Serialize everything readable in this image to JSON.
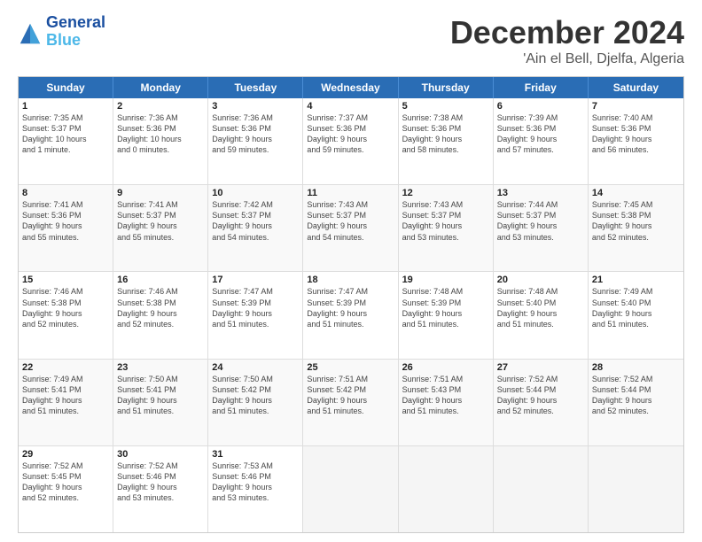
{
  "logo": {
    "line1": "General",
    "line2": "Blue"
  },
  "title": "December 2024",
  "location": "'Ain el Bell, Djelfa, Algeria",
  "weekdays": [
    "Sunday",
    "Monday",
    "Tuesday",
    "Wednesday",
    "Thursday",
    "Friday",
    "Saturday"
  ],
  "rows": [
    [
      {
        "day": "1",
        "info": "Sunrise: 7:35 AM\nSunset: 5:37 PM\nDaylight: 10 hours\nand 1 minute."
      },
      {
        "day": "2",
        "info": "Sunrise: 7:36 AM\nSunset: 5:36 PM\nDaylight: 10 hours\nand 0 minutes."
      },
      {
        "day": "3",
        "info": "Sunrise: 7:36 AM\nSunset: 5:36 PM\nDaylight: 9 hours\nand 59 minutes."
      },
      {
        "day": "4",
        "info": "Sunrise: 7:37 AM\nSunset: 5:36 PM\nDaylight: 9 hours\nand 59 minutes."
      },
      {
        "day": "5",
        "info": "Sunrise: 7:38 AM\nSunset: 5:36 PM\nDaylight: 9 hours\nand 58 minutes."
      },
      {
        "day": "6",
        "info": "Sunrise: 7:39 AM\nSunset: 5:36 PM\nDaylight: 9 hours\nand 57 minutes."
      },
      {
        "day": "7",
        "info": "Sunrise: 7:40 AM\nSunset: 5:36 PM\nDaylight: 9 hours\nand 56 minutes."
      }
    ],
    [
      {
        "day": "8",
        "info": "Sunrise: 7:41 AM\nSunset: 5:36 PM\nDaylight: 9 hours\nand 55 minutes."
      },
      {
        "day": "9",
        "info": "Sunrise: 7:41 AM\nSunset: 5:37 PM\nDaylight: 9 hours\nand 55 minutes."
      },
      {
        "day": "10",
        "info": "Sunrise: 7:42 AM\nSunset: 5:37 PM\nDaylight: 9 hours\nand 54 minutes."
      },
      {
        "day": "11",
        "info": "Sunrise: 7:43 AM\nSunset: 5:37 PM\nDaylight: 9 hours\nand 54 minutes."
      },
      {
        "day": "12",
        "info": "Sunrise: 7:43 AM\nSunset: 5:37 PM\nDaylight: 9 hours\nand 53 minutes."
      },
      {
        "day": "13",
        "info": "Sunrise: 7:44 AM\nSunset: 5:37 PM\nDaylight: 9 hours\nand 53 minutes."
      },
      {
        "day": "14",
        "info": "Sunrise: 7:45 AM\nSunset: 5:38 PM\nDaylight: 9 hours\nand 52 minutes."
      }
    ],
    [
      {
        "day": "15",
        "info": "Sunrise: 7:46 AM\nSunset: 5:38 PM\nDaylight: 9 hours\nand 52 minutes."
      },
      {
        "day": "16",
        "info": "Sunrise: 7:46 AM\nSunset: 5:38 PM\nDaylight: 9 hours\nand 52 minutes."
      },
      {
        "day": "17",
        "info": "Sunrise: 7:47 AM\nSunset: 5:39 PM\nDaylight: 9 hours\nand 51 minutes."
      },
      {
        "day": "18",
        "info": "Sunrise: 7:47 AM\nSunset: 5:39 PM\nDaylight: 9 hours\nand 51 minutes."
      },
      {
        "day": "19",
        "info": "Sunrise: 7:48 AM\nSunset: 5:39 PM\nDaylight: 9 hours\nand 51 minutes."
      },
      {
        "day": "20",
        "info": "Sunrise: 7:48 AM\nSunset: 5:40 PM\nDaylight: 9 hours\nand 51 minutes."
      },
      {
        "day": "21",
        "info": "Sunrise: 7:49 AM\nSunset: 5:40 PM\nDaylight: 9 hours\nand 51 minutes."
      }
    ],
    [
      {
        "day": "22",
        "info": "Sunrise: 7:49 AM\nSunset: 5:41 PM\nDaylight: 9 hours\nand 51 minutes."
      },
      {
        "day": "23",
        "info": "Sunrise: 7:50 AM\nSunset: 5:41 PM\nDaylight: 9 hours\nand 51 minutes."
      },
      {
        "day": "24",
        "info": "Sunrise: 7:50 AM\nSunset: 5:42 PM\nDaylight: 9 hours\nand 51 minutes."
      },
      {
        "day": "25",
        "info": "Sunrise: 7:51 AM\nSunset: 5:42 PM\nDaylight: 9 hours\nand 51 minutes."
      },
      {
        "day": "26",
        "info": "Sunrise: 7:51 AM\nSunset: 5:43 PM\nDaylight: 9 hours\nand 51 minutes."
      },
      {
        "day": "27",
        "info": "Sunrise: 7:52 AM\nSunset: 5:44 PM\nDaylight: 9 hours\nand 52 minutes."
      },
      {
        "day": "28",
        "info": "Sunrise: 7:52 AM\nSunset: 5:44 PM\nDaylight: 9 hours\nand 52 minutes."
      }
    ],
    [
      {
        "day": "29",
        "info": "Sunrise: 7:52 AM\nSunset: 5:45 PM\nDaylight: 9 hours\nand 52 minutes."
      },
      {
        "day": "30",
        "info": "Sunrise: 7:52 AM\nSunset: 5:46 PM\nDaylight: 9 hours\nand 53 minutes."
      },
      {
        "day": "31",
        "info": "Sunrise: 7:53 AM\nSunset: 5:46 PM\nDaylight: 9 hours\nand 53 minutes."
      },
      {
        "day": "",
        "info": ""
      },
      {
        "day": "",
        "info": ""
      },
      {
        "day": "",
        "info": ""
      },
      {
        "day": "",
        "info": ""
      }
    ]
  ]
}
